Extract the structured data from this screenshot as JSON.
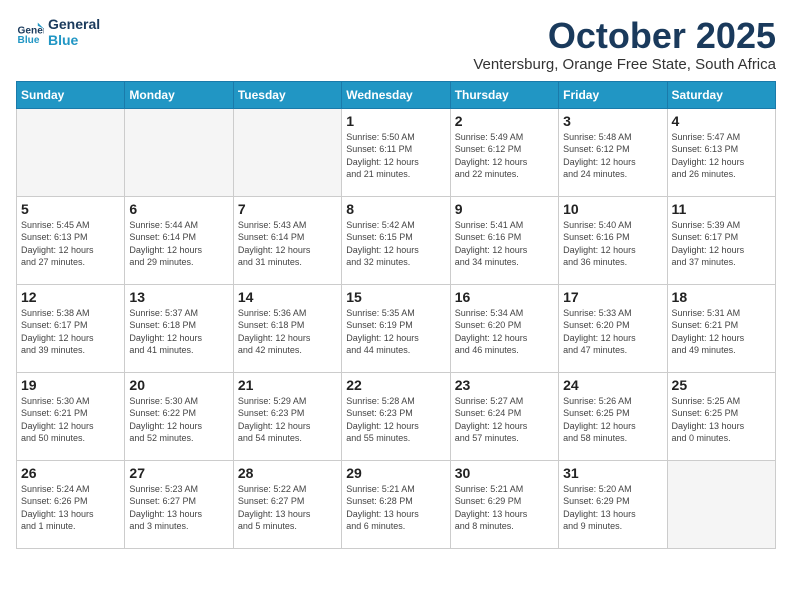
{
  "logo": {
    "line1": "General",
    "line2": "Blue"
  },
  "title": "October 2025",
  "subtitle": "Ventersburg, Orange Free State, South Africa",
  "weekdays": [
    "Sunday",
    "Monday",
    "Tuesday",
    "Wednesday",
    "Thursday",
    "Friday",
    "Saturday"
  ],
  "weeks": [
    [
      {
        "day": "",
        "info": ""
      },
      {
        "day": "",
        "info": ""
      },
      {
        "day": "",
        "info": ""
      },
      {
        "day": "1",
        "info": "Sunrise: 5:50 AM\nSunset: 6:11 PM\nDaylight: 12 hours\nand 21 minutes."
      },
      {
        "day": "2",
        "info": "Sunrise: 5:49 AM\nSunset: 6:12 PM\nDaylight: 12 hours\nand 22 minutes."
      },
      {
        "day": "3",
        "info": "Sunrise: 5:48 AM\nSunset: 6:12 PM\nDaylight: 12 hours\nand 24 minutes."
      },
      {
        "day": "4",
        "info": "Sunrise: 5:47 AM\nSunset: 6:13 PM\nDaylight: 12 hours\nand 26 minutes."
      }
    ],
    [
      {
        "day": "5",
        "info": "Sunrise: 5:45 AM\nSunset: 6:13 PM\nDaylight: 12 hours\nand 27 minutes."
      },
      {
        "day": "6",
        "info": "Sunrise: 5:44 AM\nSunset: 6:14 PM\nDaylight: 12 hours\nand 29 minutes."
      },
      {
        "day": "7",
        "info": "Sunrise: 5:43 AM\nSunset: 6:14 PM\nDaylight: 12 hours\nand 31 minutes."
      },
      {
        "day": "8",
        "info": "Sunrise: 5:42 AM\nSunset: 6:15 PM\nDaylight: 12 hours\nand 32 minutes."
      },
      {
        "day": "9",
        "info": "Sunrise: 5:41 AM\nSunset: 6:16 PM\nDaylight: 12 hours\nand 34 minutes."
      },
      {
        "day": "10",
        "info": "Sunrise: 5:40 AM\nSunset: 6:16 PM\nDaylight: 12 hours\nand 36 minutes."
      },
      {
        "day": "11",
        "info": "Sunrise: 5:39 AM\nSunset: 6:17 PM\nDaylight: 12 hours\nand 37 minutes."
      }
    ],
    [
      {
        "day": "12",
        "info": "Sunrise: 5:38 AM\nSunset: 6:17 PM\nDaylight: 12 hours\nand 39 minutes."
      },
      {
        "day": "13",
        "info": "Sunrise: 5:37 AM\nSunset: 6:18 PM\nDaylight: 12 hours\nand 41 minutes."
      },
      {
        "day": "14",
        "info": "Sunrise: 5:36 AM\nSunset: 6:18 PM\nDaylight: 12 hours\nand 42 minutes."
      },
      {
        "day": "15",
        "info": "Sunrise: 5:35 AM\nSunset: 6:19 PM\nDaylight: 12 hours\nand 44 minutes."
      },
      {
        "day": "16",
        "info": "Sunrise: 5:34 AM\nSunset: 6:20 PM\nDaylight: 12 hours\nand 46 minutes."
      },
      {
        "day": "17",
        "info": "Sunrise: 5:33 AM\nSunset: 6:20 PM\nDaylight: 12 hours\nand 47 minutes."
      },
      {
        "day": "18",
        "info": "Sunrise: 5:31 AM\nSunset: 6:21 PM\nDaylight: 12 hours\nand 49 minutes."
      }
    ],
    [
      {
        "day": "19",
        "info": "Sunrise: 5:30 AM\nSunset: 6:21 PM\nDaylight: 12 hours\nand 50 minutes."
      },
      {
        "day": "20",
        "info": "Sunrise: 5:30 AM\nSunset: 6:22 PM\nDaylight: 12 hours\nand 52 minutes."
      },
      {
        "day": "21",
        "info": "Sunrise: 5:29 AM\nSunset: 6:23 PM\nDaylight: 12 hours\nand 54 minutes."
      },
      {
        "day": "22",
        "info": "Sunrise: 5:28 AM\nSunset: 6:23 PM\nDaylight: 12 hours\nand 55 minutes."
      },
      {
        "day": "23",
        "info": "Sunrise: 5:27 AM\nSunset: 6:24 PM\nDaylight: 12 hours\nand 57 minutes."
      },
      {
        "day": "24",
        "info": "Sunrise: 5:26 AM\nSunset: 6:25 PM\nDaylight: 12 hours\nand 58 minutes."
      },
      {
        "day": "25",
        "info": "Sunrise: 5:25 AM\nSunset: 6:25 PM\nDaylight: 13 hours\nand 0 minutes."
      }
    ],
    [
      {
        "day": "26",
        "info": "Sunrise: 5:24 AM\nSunset: 6:26 PM\nDaylight: 13 hours\nand 1 minute."
      },
      {
        "day": "27",
        "info": "Sunrise: 5:23 AM\nSunset: 6:27 PM\nDaylight: 13 hours\nand 3 minutes."
      },
      {
        "day": "28",
        "info": "Sunrise: 5:22 AM\nSunset: 6:27 PM\nDaylight: 13 hours\nand 5 minutes."
      },
      {
        "day": "29",
        "info": "Sunrise: 5:21 AM\nSunset: 6:28 PM\nDaylight: 13 hours\nand 6 minutes."
      },
      {
        "day": "30",
        "info": "Sunrise: 5:21 AM\nSunset: 6:29 PM\nDaylight: 13 hours\nand 8 minutes."
      },
      {
        "day": "31",
        "info": "Sunrise: 5:20 AM\nSunset: 6:29 PM\nDaylight: 13 hours\nand 9 minutes."
      },
      {
        "day": "",
        "info": ""
      }
    ]
  ]
}
